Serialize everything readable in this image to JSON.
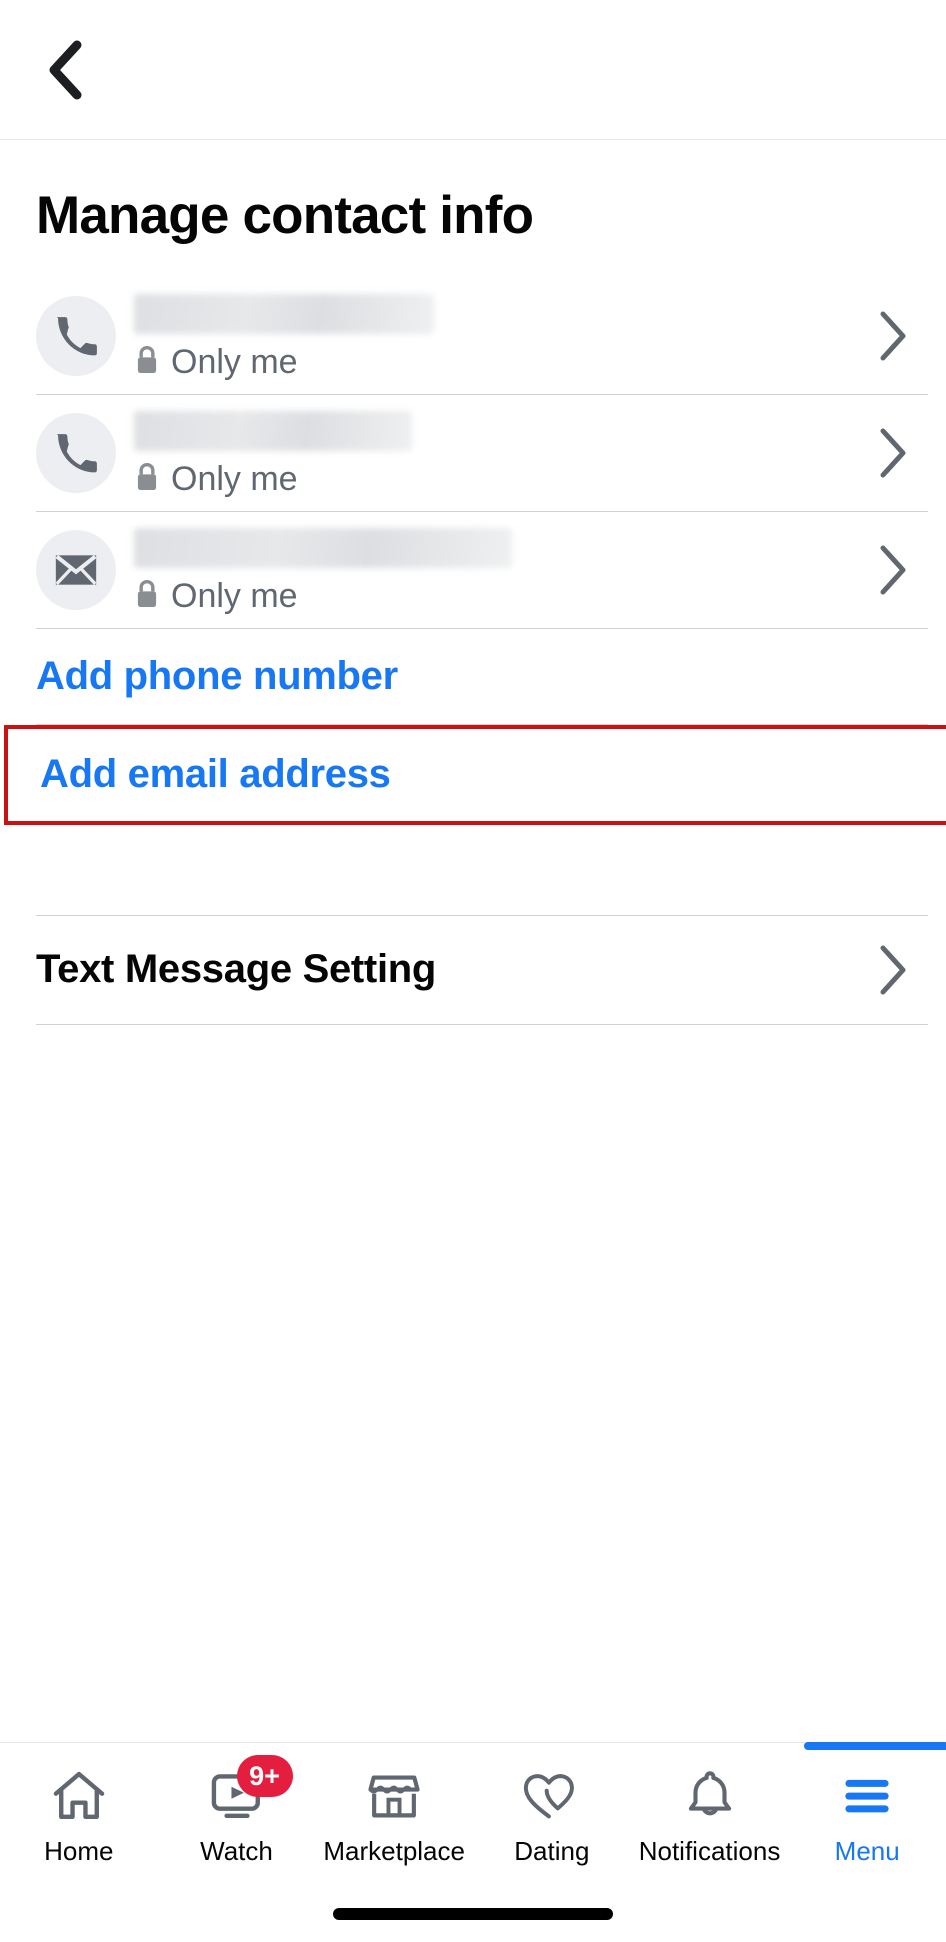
{
  "header": {
    "back_icon": "chevron-left-icon",
    "title": "Manage contact info"
  },
  "contacts": [
    {
      "icon": "phone-icon",
      "value_redacted": true,
      "privacy_icon": "lock-icon",
      "privacy_label": "Only me",
      "chevron": "chevron-right-icon"
    },
    {
      "icon": "phone-icon",
      "value_redacted": true,
      "privacy_icon": "lock-icon",
      "privacy_label": "Only me",
      "chevron": "chevron-right-icon"
    },
    {
      "icon": "envelope-icon",
      "value_redacted": true,
      "privacy_icon": "lock-icon",
      "privacy_label": "Only me",
      "chevron": "chevron-right-icon"
    }
  ],
  "actions": {
    "add_phone_label": "Add phone number",
    "add_email_label": "Add email address",
    "highlight_color": "#cc1111",
    "link_color": "#1877f2"
  },
  "settings": {
    "text_message_label": "Text Message Setting",
    "chevron": "chevron-right-icon"
  },
  "bottom_nav": {
    "items": [
      {
        "icon": "home-icon",
        "label": "Home",
        "active": false,
        "badge": ""
      },
      {
        "icon": "watch-icon",
        "label": "Watch",
        "active": false,
        "badge": "9+"
      },
      {
        "icon": "marketplace-icon",
        "label": "Marketplace",
        "active": false,
        "badge": ""
      },
      {
        "icon": "dating-hearts-icon",
        "label": "Dating",
        "active": false,
        "badge": ""
      },
      {
        "icon": "bell-icon",
        "label": "Notifications",
        "active": false,
        "badge": ""
      },
      {
        "icon": "hamburger-menu-icon",
        "label": "Menu",
        "active": true,
        "badge": ""
      }
    ],
    "active_color": "#1877f2",
    "badge_color": "#e41e3f"
  }
}
